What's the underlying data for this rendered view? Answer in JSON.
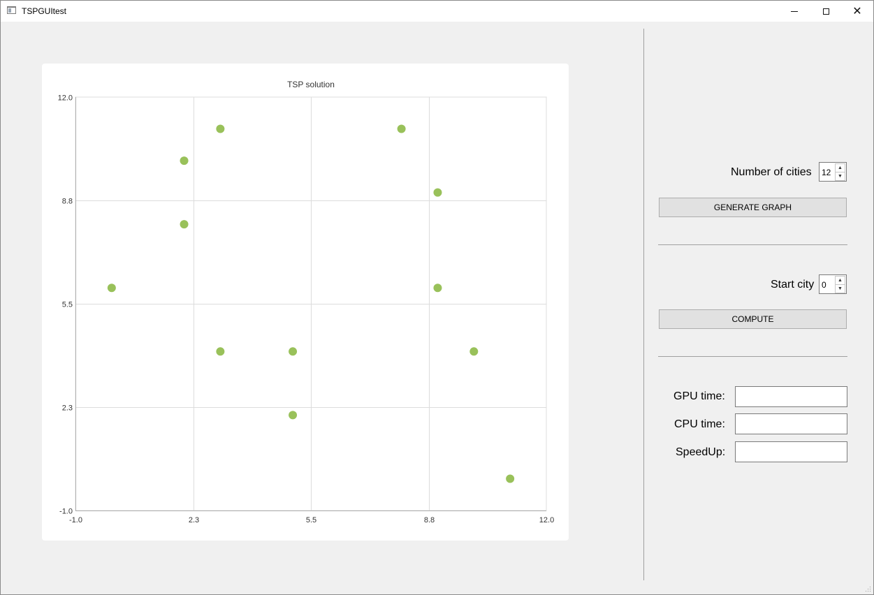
{
  "window": {
    "title": "TSPGUItest",
    "icon": "app-window-icon",
    "controls": {
      "minimize": "minimize-icon",
      "maximize": "maximize-icon",
      "close": "close-icon",
      "close_glyph": "✕"
    }
  },
  "chart_data": {
    "type": "scatter",
    "title": "TSP solution",
    "xlabel": "",
    "ylabel": "",
    "xlim": [
      -1.0,
      12.0
    ],
    "ylim": [
      -1.0,
      12.0
    ],
    "x_ticks": [
      "-1.0",
      "2.3",
      "5.5",
      "8.8",
      "12.0"
    ],
    "y_ticks": [
      "-1.0",
      "2.3",
      "5.5",
      "8.8",
      "12.0"
    ],
    "grid": true,
    "marker_color": "#99c15a",
    "points": [
      {
        "x": 0,
        "y": 6
      },
      {
        "x": 2,
        "y": 10
      },
      {
        "x": 2,
        "y": 8
      },
      {
        "x": 3,
        "y": 11
      },
      {
        "x": 3,
        "y": 4
      },
      {
        "x": 5,
        "y": 4
      },
      {
        "x": 5,
        "y": 2
      },
      {
        "x": 8,
        "y": 11
      },
      {
        "x": 9,
        "y": 9
      },
      {
        "x": 9,
        "y": 6
      },
      {
        "x": 10,
        "y": 4
      },
      {
        "x": 11,
        "y": 0
      }
    ]
  },
  "controls": {
    "num_cities_label": "Number of cities",
    "num_cities_value": "12",
    "generate_label": "GENERATE GRAPH",
    "start_city_label": "Start city",
    "start_city_value": "0",
    "compute_label": "COMPUTE",
    "gpu_time_label": "GPU time:",
    "cpu_time_label": "CPU time:",
    "speedup_label": "SpeedUp:",
    "gpu_time_value": "",
    "cpu_time_value": "",
    "speedup_value": ""
  },
  "spin_up_glyph": "▲",
  "spin_down_glyph": "▼"
}
